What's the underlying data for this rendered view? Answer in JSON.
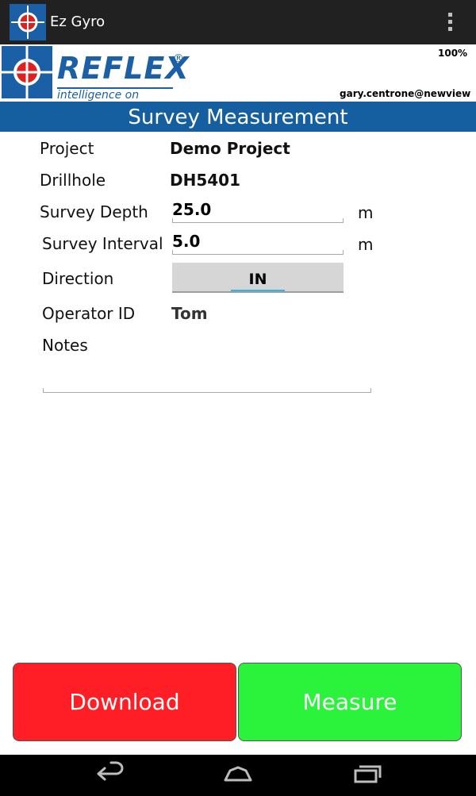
{
  "app": {
    "title": "Ez Gyro"
  },
  "header": {
    "logo_text": "REFLEX",
    "logo_registered": "®",
    "logo_tagline": "intelligence on demand",
    "battery": "100%",
    "user": "gary.centrone@newview"
  },
  "section_title": "Survey Measurement",
  "form": {
    "project": {
      "label": "Project",
      "value": "Demo Project"
    },
    "drillhole": {
      "label": "Drillhole",
      "value": "DH5401"
    },
    "survey_depth": {
      "label": "Survey Depth",
      "value": "25.0",
      "unit": "m"
    },
    "survey_interval": {
      "label": "Survey Interval",
      "value": "5.0",
      "unit": "m"
    },
    "direction": {
      "label": "Direction",
      "value": "IN"
    },
    "operator": {
      "label": "Operator ID",
      "value": "Tom"
    },
    "notes": {
      "label": "Notes",
      "value": ""
    }
  },
  "buttons": {
    "download": "Download",
    "measure": "Measure"
  },
  "icons": {
    "app": "crosshair-icon",
    "overflow": "overflow-menu-icon",
    "back": "back-icon",
    "home": "home-icon",
    "recents": "recent-apps-icon"
  },
  "colors": {
    "brand_blue": "#155fa0",
    "download_red": "#ff1e26",
    "measure_green": "#2bf23a",
    "actionbar": "#212121"
  }
}
